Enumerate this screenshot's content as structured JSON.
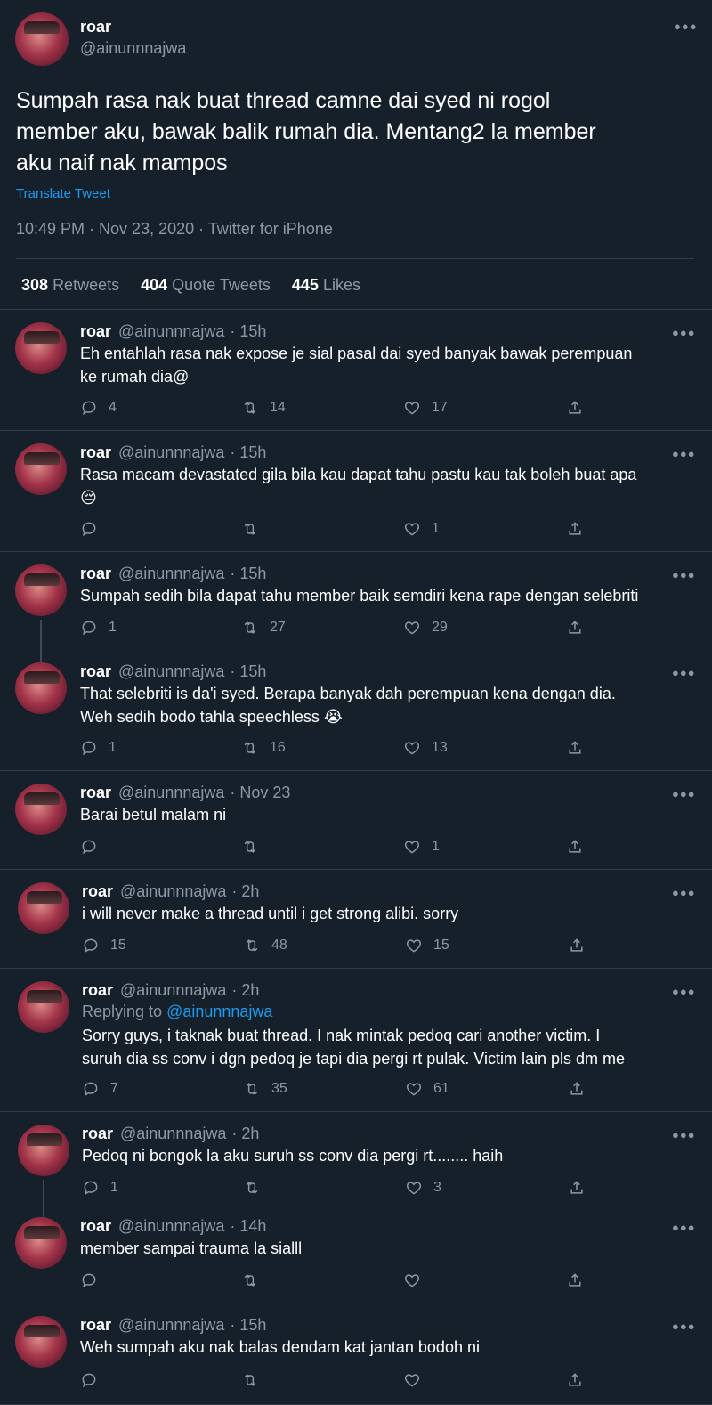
{
  "main_tweet": {
    "name": "roar",
    "handle": "@ainunnnajwa",
    "text_lines": [
      "Sumpah rasa nak buat thread camne dai syed ni rogol",
      "member aku, bawak balik rumah dia. Mentang2 la member",
      "aku naif nak mampos"
    ],
    "translate": "Translate Tweet",
    "meta": "10:49 PM · Nov 23, 2020 · Twitter for iPhone",
    "retweets_count": "308",
    "retweets_label": "Retweets",
    "quotes_count": "404",
    "quotes_label": "Quote Tweets",
    "likes_count": "445",
    "likes_label": "Likes"
  },
  "replies": [
    {
      "name": "roar",
      "handle": "@ainunnnajwa",
      "time": "· 15h",
      "lines": [
        "Eh entahlah rasa nak expose je sial pasal dai syed banyak bawak perempuan",
        "ke rumah dia@"
      ],
      "reply": "4",
      "retweet": "14",
      "like": "17"
    },
    {
      "name": "roar",
      "handle": "@ainunnnajwa",
      "time": "· 15h",
      "lines": [
        "Rasa macam devastated gila bila kau dapat tahu pastu kau tak boleh buat apa",
        "😔"
      ],
      "reply": "",
      "retweet": "",
      "like": "1"
    },
    {
      "name": "roar",
      "handle": "@ainunnnajwa",
      "time": "· 15h",
      "lines": [
        "Sumpah sedih bila dapat tahu member baik semdiri kena rape dengan selebriti"
      ],
      "reply": "1",
      "retweet": "27",
      "like": "29"
    },
    {
      "name": "roar",
      "handle": "@ainunnnajwa",
      "time": "· 15h",
      "lines": [
        "That selebriti is da'i syed. Berapa banyak dah perempuan kena dengan dia.",
        "Weh sedih bodo tahla speechless 😭"
      ],
      "reply": "1",
      "retweet": "16",
      "like": "13"
    },
    {
      "name": "roar",
      "handle": "@ainunnnajwa",
      "time": "· Nov 23",
      "lines": [
        "Barai betul malam ni"
      ],
      "reply": "",
      "retweet": "",
      "like": "1"
    },
    {
      "name": "roar",
      "handle": "@ainunnnajwa",
      "time": "· 2h",
      "lines": [
        "i will never make a thread until i get strong alibi. sorry"
      ],
      "reply": "15",
      "retweet": "48",
      "like": "15"
    },
    {
      "name": "roar",
      "handle": "@ainunnnajwa",
      "time": "· 2h",
      "replying_prefix": "Replying to ",
      "replying_to": "@ainunnnajwa",
      "lines": [
        "Sorry guys, i taknak buat thread. I nak mintak pedoq cari another victim. I",
        "suruh dia ss conv i dgn pedoq je tapi dia pergi rt pulak. Victim lain pls dm me"
      ],
      "reply": "7",
      "retweet": "35",
      "like": "61"
    },
    {
      "name": "roar",
      "handle": "@ainunnnajwa",
      "time": "· 2h",
      "lines": [
        "Pedoq ni bongok la aku suruh ss conv dia pergi rt........ haih"
      ],
      "reply": "1",
      "retweet": "",
      "like": "3"
    },
    {
      "name": "roar",
      "handle": "@ainunnnajwa",
      "time": "· 14h",
      "lines": [
        "member sampai trauma la sialll"
      ],
      "reply": "",
      "retweet": "",
      "like": ""
    },
    {
      "name": "roar",
      "handle": "@ainunnnajwa",
      "time": "· 15h",
      "lines": [
        "Weh sumpah aku nak balas dendam kat jantan bodoh ni"
      ],
      "reply": "",
      "retweet": "",
      "like": ""
    }
  ],
  "icons": {
    "reply": "reply-icon",
    "retweet": "retweet-icon",
    "like": "heart-icon",
    "share": "share-icon",
    "more": "more-icon"
  },
  "colors": {
    "background": "#15202b",
    "link": "#1d9bf0",
    "muted": "#8b98a5"
  }
}
